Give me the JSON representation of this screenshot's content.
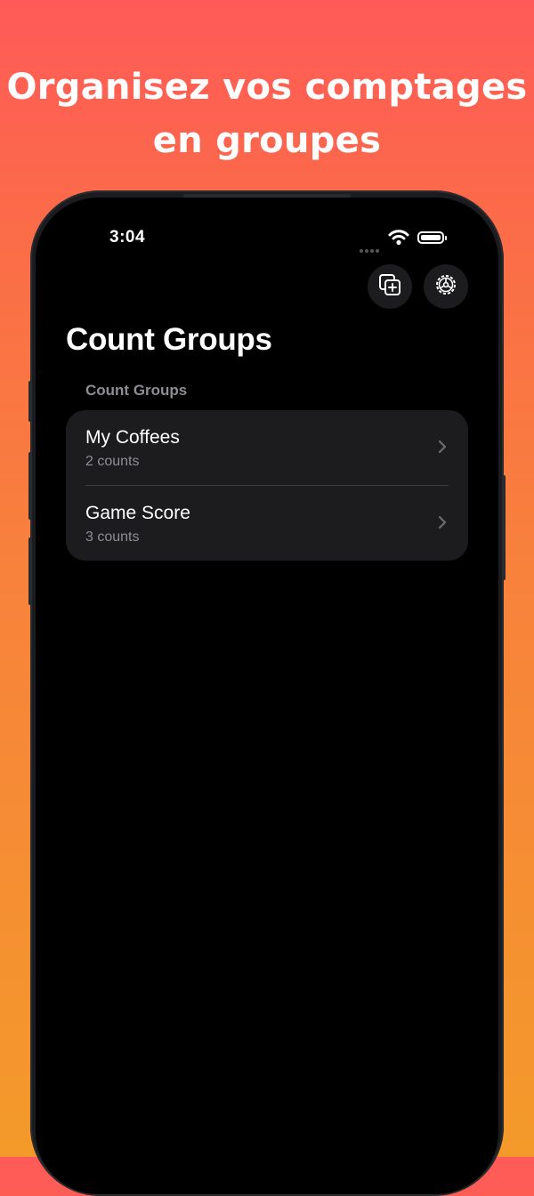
{
  "headline": {
    "line1": "Organisez vos comptages",
    "line2": "en groupes"
  },
  "status_bar": {
    "time": "3:04",
    "icons": [
      "signal-dots-icon",
      "wifi-icon",
      "battery-icon"
    ]
  },
  "toolbar": {
    "icons": [
      "add-group-icon",
      "gear-icon"
    ]
  },
  "page": {
    "title": "Count Groups"
  },
  "list": {
    "section_header": "Count Groups",
    "items": [
      {
        "title": "My Coffees",
        "subtitle": "2 counts"
      },
      {
        "title": "Game Score",
        "subtitle": "3 counts"
      }
    ]
  },
  "colors": {
    "gradient_top": "#ff5a58",
    "gradient_bottom": "#f39a2a",
    "screen_background": "#000000",
    "card_background": "#1c1c1e",
    "secondary_text": "#8d8d93"
  }
}
